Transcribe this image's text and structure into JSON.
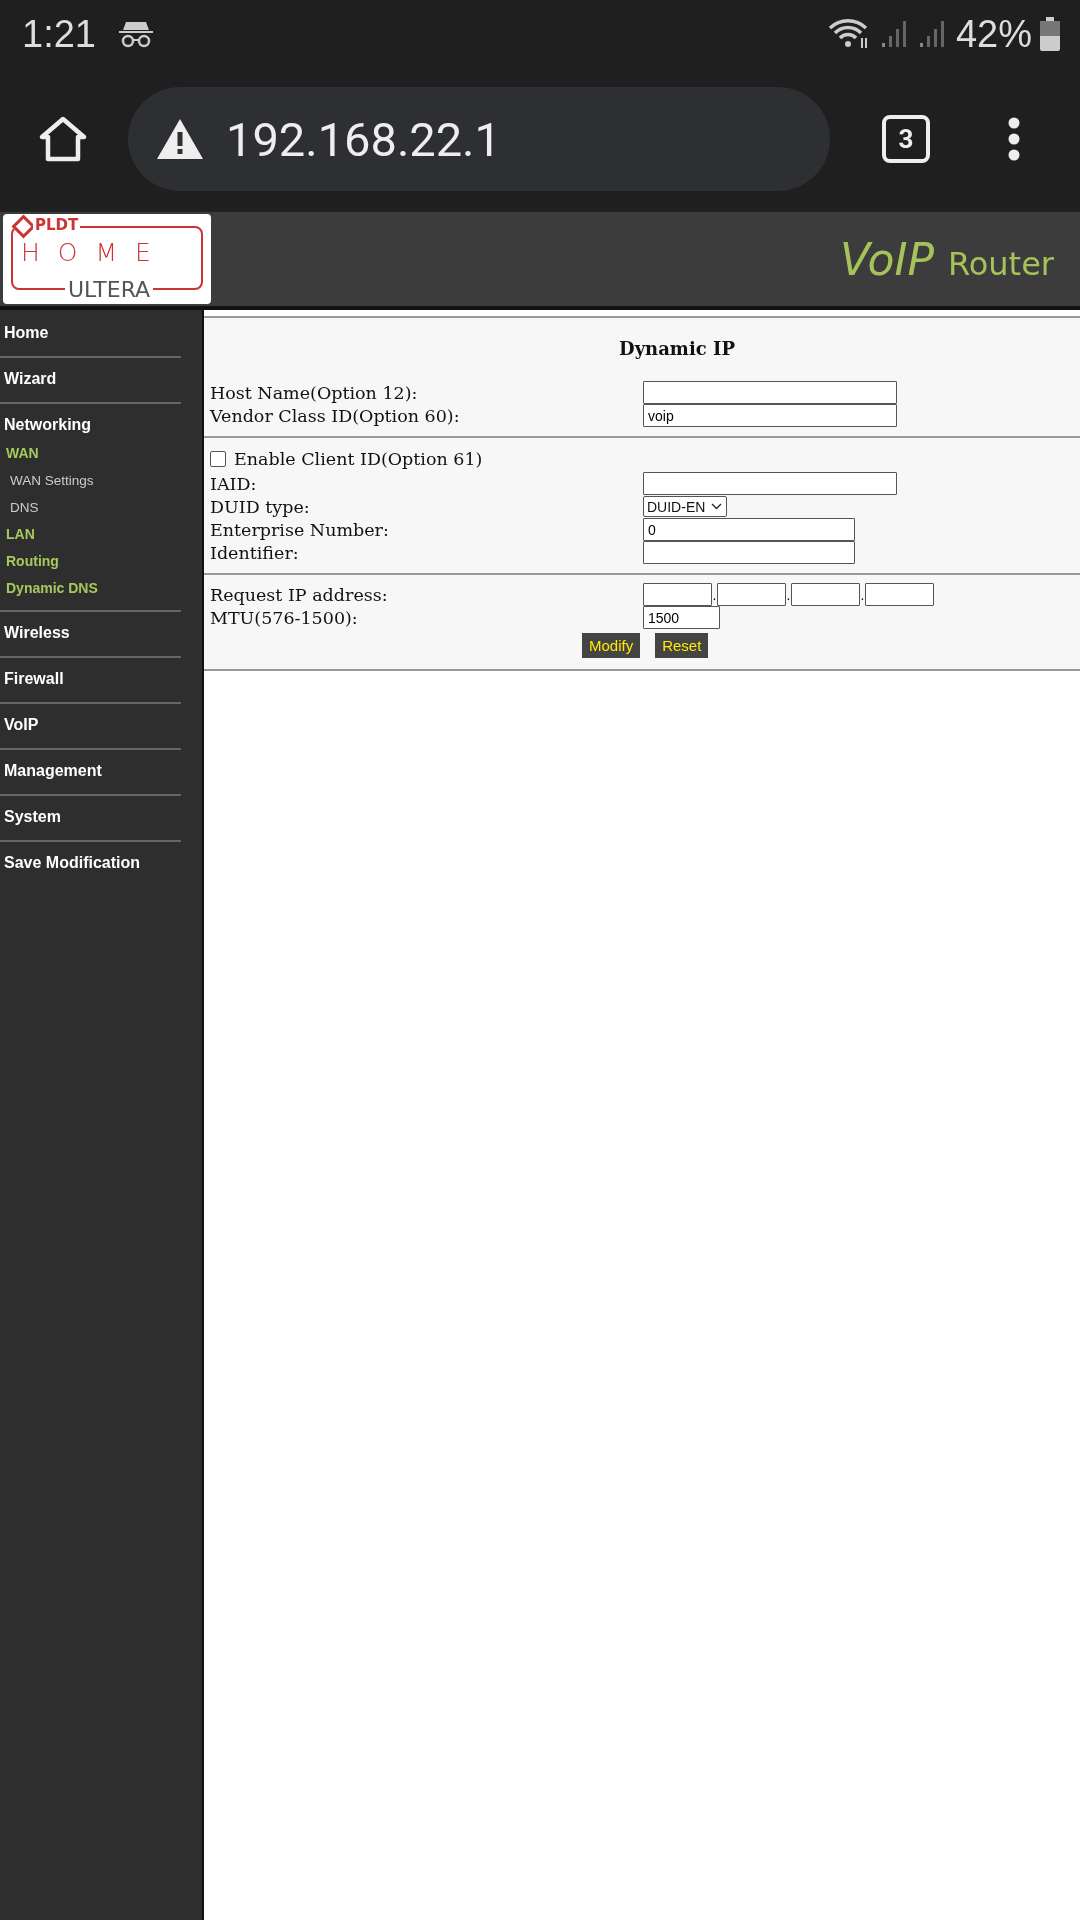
{
  "status_bar": {
    "time": "1:21",
    "battery": "42%"
  },
  "browser": {
    "address": "192.168.22.1",
    "tab_count": "3"
  },
  "header": {
    "logo": {
      "brand": "PLDT",
      "line1": "HOME",
      "line2": "ULTERA"
    },
    "title": "VoIP",
    "subtitle": "Router"
  },
  "sidebar": {
    "items": [
      {
        "label": "Home"
      },
      {
        "label": "Wizard"
      },
      {
        "label": "Networking",
        "children": [
          {
            "label": "WAN",
            "children": [
              {
                "label": "WAN Settings"
              },
              {
                "label": "DNS"
              }
            ]
          },
          {
            "label": "LAN"
          },
          {
            "label": "Routing"
          },
          {
            "label": "Dynamic DNS"
          }
        ]
      },
      {
        "label": "Wireless"
      },
      {
        "label": "Firewall"
      },
      {
        "label": "VoIP"
      },
      {
        "label": "Management"
      },
      {
        "label": "System"
      },
      {
        "label": "Save Modification"
      }
    ]
  },
  "form": {
    "title": "Dynamic IP",
    "sections": [
      {
        "rows": [
          {
            "kind": "long",
            "label": "Host Name(Option 12):"
          },
          {
            "kind": "long",
            "label": "Vendor Class ID(Option 60):",
            "value": "voip"
          }
        ]
      },
      {
        "rows": [
          {
            "kind": "checkbox",
            "label": "Enable Client ID(Option 61)",
            "checked": false
          },
          {
            "kind": "long",
            "label": "IAID:"
          },
          {
            "kind": "select",
            "label": "DUID type:",
            "value": "DUID-EN"
          },
          {
            "kind": "short",
            "label": "Enterprise Number:",
            "value": "0"
          },
          {
            "kind": "short",
            "label": "Identifier:"
          }
        ]
      },
      {
        "rows": [
          {
            "kind": "ip",
            "label": "Request IP address:",
            "separator": "."
          },
          {
            "kind": "tiny",
            "label": "MTU(576-1500):",
            "value": "1500"
          }
        ],
        "buttons": [
          "Modify",
          "Reset"
        ]
      }
    ]
  }
}
